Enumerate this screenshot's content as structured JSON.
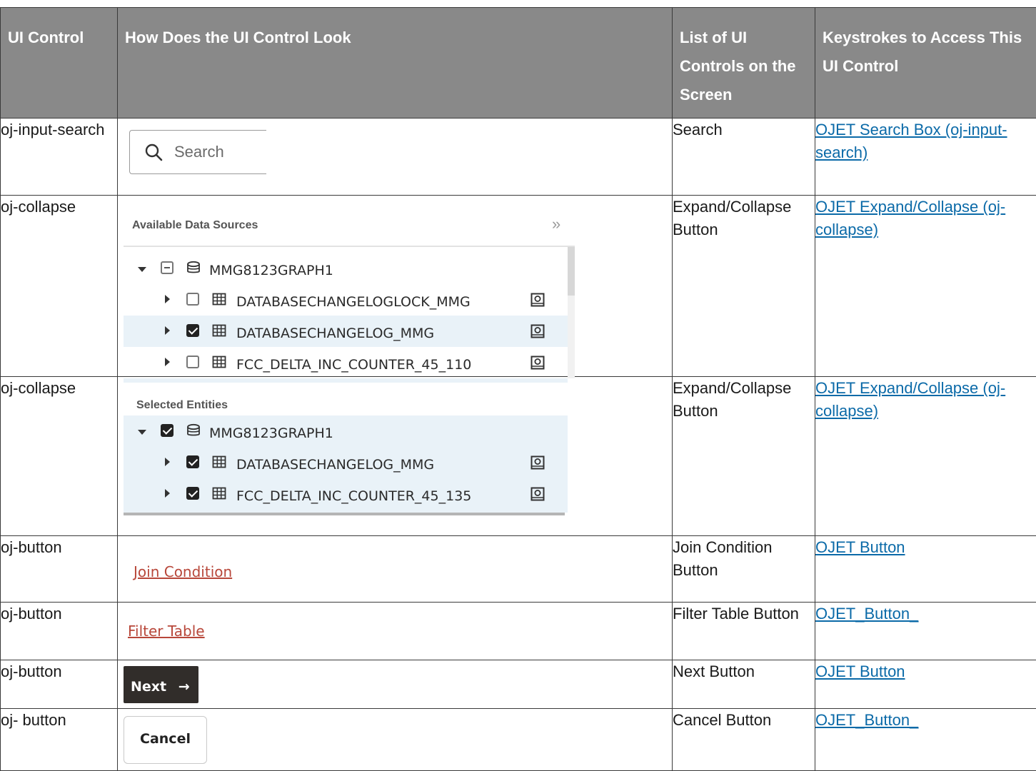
{
  "headers": {
    "ui_control": "UI Control",
    "look": "How Does the UI Control Look",
    "list": "List of UI Controls on the Screen",
    "keys": "Keystrokes to Access This UI Control"
  },
  "rows": [
    {
      "control": "oj-input-search",
      "list": "Search",
      "link": "OJET Search Box (oj-input-search)"
    },
    {
      "control": "oj-collapse",
      "list": "Expand/Collapse Button",
      "link": "OJET Expand/Collapse (oj-collapse)"
    },
    {
      "control": "oj-collapse",
      "list": "Expand/Collapse Button",
      "link": "OJET Expand/Collapse (oj-collapse)"
    },
    {
      "control": "oj-button",
      "list": "Join Condition Button",
      "link": "OJET Button"
    },
    {
      "control": "oj-button",
      "list": "Filter Table Button",
      "link": "OJET_Button_"
    },
    {
      "control": "oj-button",
      "list": "Next Button",
      "link": "OJET Button"
    },
    {
      "control": "oj- button",
      "list": "Cancel Button",
      "link": "OJET_Button_"
    }
  ],
  "search": {
    "placeholder": "Search",
    "icon": "search-icon"
  },
  "available_panel": {
    "title": "Available Data Sources",
    "collapse_glyph": "»",
    "root": "MMG8123GRAPH1",
    "items": [
      {
        "label": "DATABASECHANGELOGLOCK_MMG",
        "checked": false
      },
      {
        "label": "DATABASECHANGELOG_MMG",
        "checked": true
      },
      {
        "label": "FCC_DELTA_INC_COUNTER_45_110",
        "checked": false
      }
    ]
  },
  "selected_panel": {
    "title": "Selected Entities",
    "root": "MMG8123GRAPH1",
    "items": [
      {
        "label": "DATABASECHANGELOG_MMG",
        "checked": true
      },
      {
        "label": "FCC_DELTA_INC_COUNTER_45_135",
        "checked": true
      }
    ]
  },
  "buttons": {
    "join_condition": "Join Condition",
    "filter_table": "Filter Table",
    "next": "Next",
    "next_arrow": "→",
    "cancel": "Cancel"
  },
  "colors": {
    "header_bg": "#898989",
    "link": "#0b6aa8",
    "link_button": "#b8473a",
    "next_bg": "#312d2a",
    "selected_row": "#e9f2f8"
  }
}
